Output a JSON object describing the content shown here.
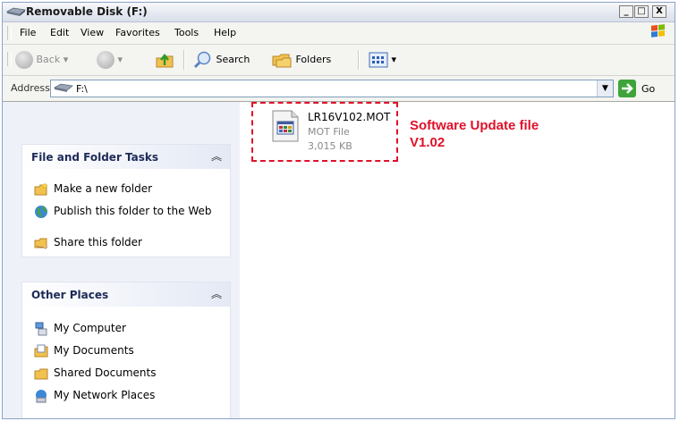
{
  "window": {
    "title": "Removable Disk (F:)",
    "min": "_",
    "max": "□",
    "close": "X"
  },
  "menu": [
    "File",
    "Edit",
    "View",
    "Favorites",
    "Tools",
    "Help"
  ],
  "toolbar": {
    "back": "Back",
    "search": "Search",
    "folders": "Folders"
  },
  "address": {
    "label": "Address",
    "value": "F:\\",
    "go": "Go"
  },
  "file_tasks": {
    "title": "File and Folder Tasks",
    "items": [
      "Make a new folder",
      "Publish this folder to the Web",
      "Share this folder"
    ]
  },
  "other_places": {
    "title": "Other Places",
    "items": [
      "My Computer",
      "My Documents",
      "Shared Documents",
      "My Network Places"
    ]
  },
  "file": {
    "name": "LR16V102.MOT",
    "type": "MOT File",
    "size": "3,015 KB"
  },
  "callout": {
    "line1": "Software Update file",
    "line2": "V1.02"
  },
  "colors": {
    "accent_red": "#e0102a",
    "pane_bg": "#eef1f8",
    "panel_title": "#1d2a57"
  },
  "icons": [
    "drive-icon",
    "back-icon",
    "forward-icon",
    "up-folder-icon",
    "search-icon",
    "folders-icon",
    "views-icon",
    "go-icon",
    "new-folder-icon",
    "publish-web-icon",
    "share-folder-icon",
    "my-computer-icon",
    "my-documents-icon",
    "shared-documents-icon",
    "network-places-icon",
    "mot-file-icon"
  ]
}
